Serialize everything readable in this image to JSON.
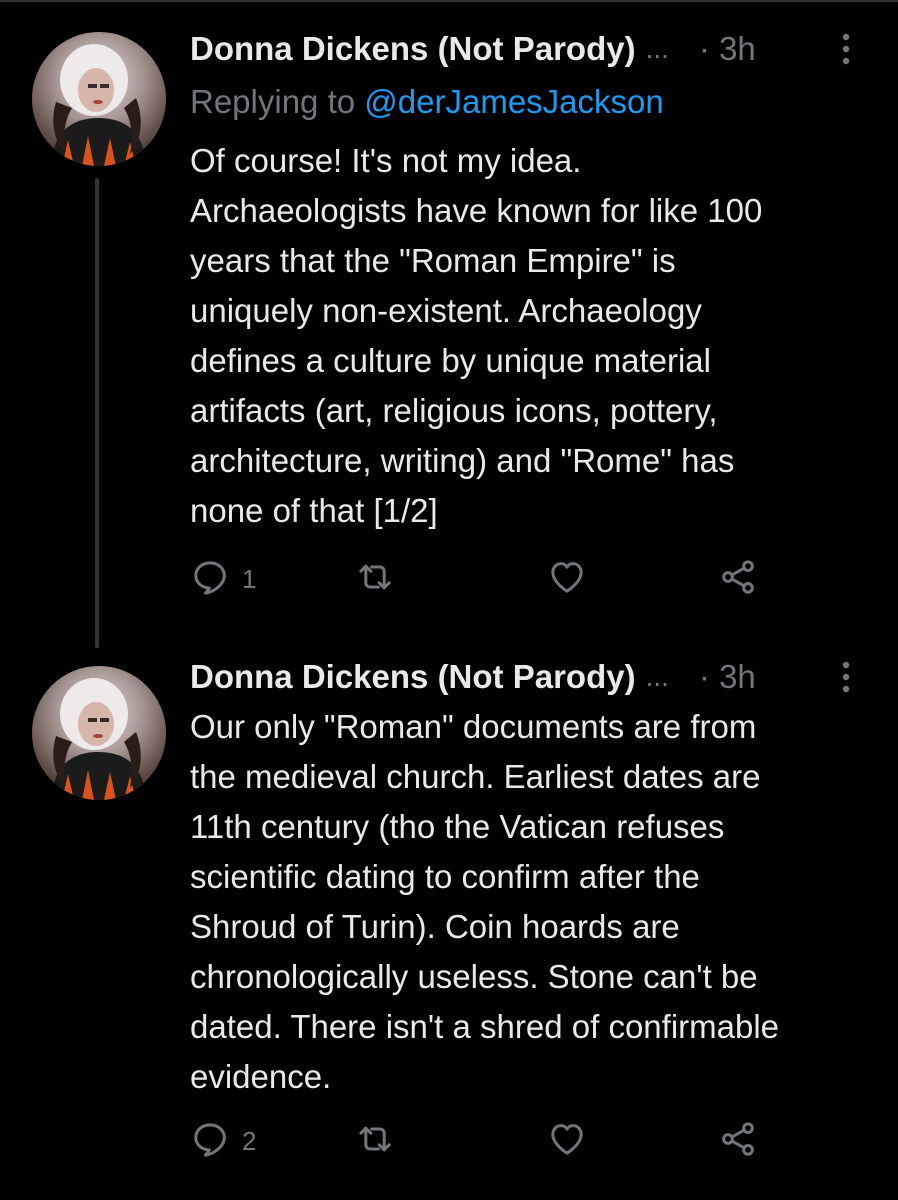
{
  "colors": {
    "background": "#000000",
    "text": "#e7e9ea",
    "secondary": "#71767b",
    "link": "#1d9bf0",
    "thread_line": "#333639"
  },
  "tweets": [
    {
      "display_name": "Donna Dickens (Not Parody)",
      "name_truncation": "...",
      "time": "· 3h",
      "replying_prefix": "Replying to",
      "replying_handle": "@derJamesJackson",
      "text": "Of course! It's not my idea.\nArchaeologists have known for like 100\nyears that the \"Roman Empire\" is\nuniquely non-existent. Archaeology\ndefines a culture by unique material\nartifacts (art, religious icons, pottery,\narchitecture, writing) and \"Rome\" has\nnone of that [1/2]",
      "reply_count": "1",
      "retweet_count": "",
      "like_count": "",
      "icons": {
        "avatar": "avatar",
        "more": "more-vertical-icon",
        "reply": "reply-icon",
        "retweet": "retweet-icon",
        "like": "heart-icon",
        "share": "share-icon"
      }
    },
    {
      "display_name": "Donna Dickens (Not Parody)",
      "name_truncation": "...",
      "time": "· 3h",
      "text": "Our only \"Roman\" documents are from\nthe medieval church. Earliest dates are\n11th century (tho the Vatican refuses\nscientific dating to confirm after the\nShroud of Turin). Coin hoards are\nchronologically useless. Stone can't be\ndated. There isn't a shred of confirmable\nevidence.",
      "reply_count": "2",
      "retweet_count": "",
      "like_count": "",
      "icons": {
        "avatar": "avatar",
        "more": "more-vertical-icon",
        "reply": "reply-icon",
        "retweet": "retweet-icon",
        "like": "heart-icon",
        "share": "share-icon"
      }
    }
  ]
}
